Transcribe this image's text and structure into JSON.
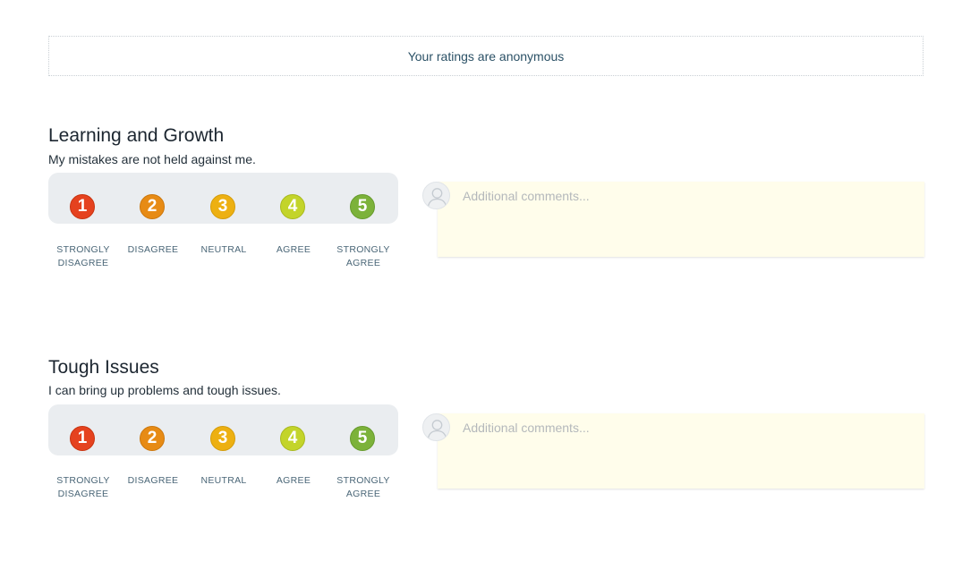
{
  "notice": "Your ratings are anonymous",
  "scale_labels": {
    "1": "STRONGLY DISAGREE",
    "2": "DISAGREE",
    "3": "NEUTRAL",
    "4": "AGREE",
    "5": "STRONGLY AGREE"
  },
  "sections": [
    {
      "title": "Learning and Growth",
      "subtitle": "My mistakes are not held against me.",
      "comment_placeholder": "Additional comments..."
    },
    {
      "title": "Tough Issues",
      "subtitle": "I can bring up problems and tough issues.",
      "comment_placeholder": "Additional comments..."
    }
  ],
  "ratings": [
    "1",
    "2",
    "3",
    "4",
    "5"
  ],
  "colors": {
    "rating_1": "#e5421f",
    "rating_2": "#e78b15",
    "rating_3": "#edb012",
    "rating_4": "#c3d42a",
    "rating_5": "#7cb23a",
    "comment_bg": "#fffdeb",
    "scale_bg": "#eaedf0"
  },
  "icons": {
    "avatar": "user-avatar-icon"
  }
}
